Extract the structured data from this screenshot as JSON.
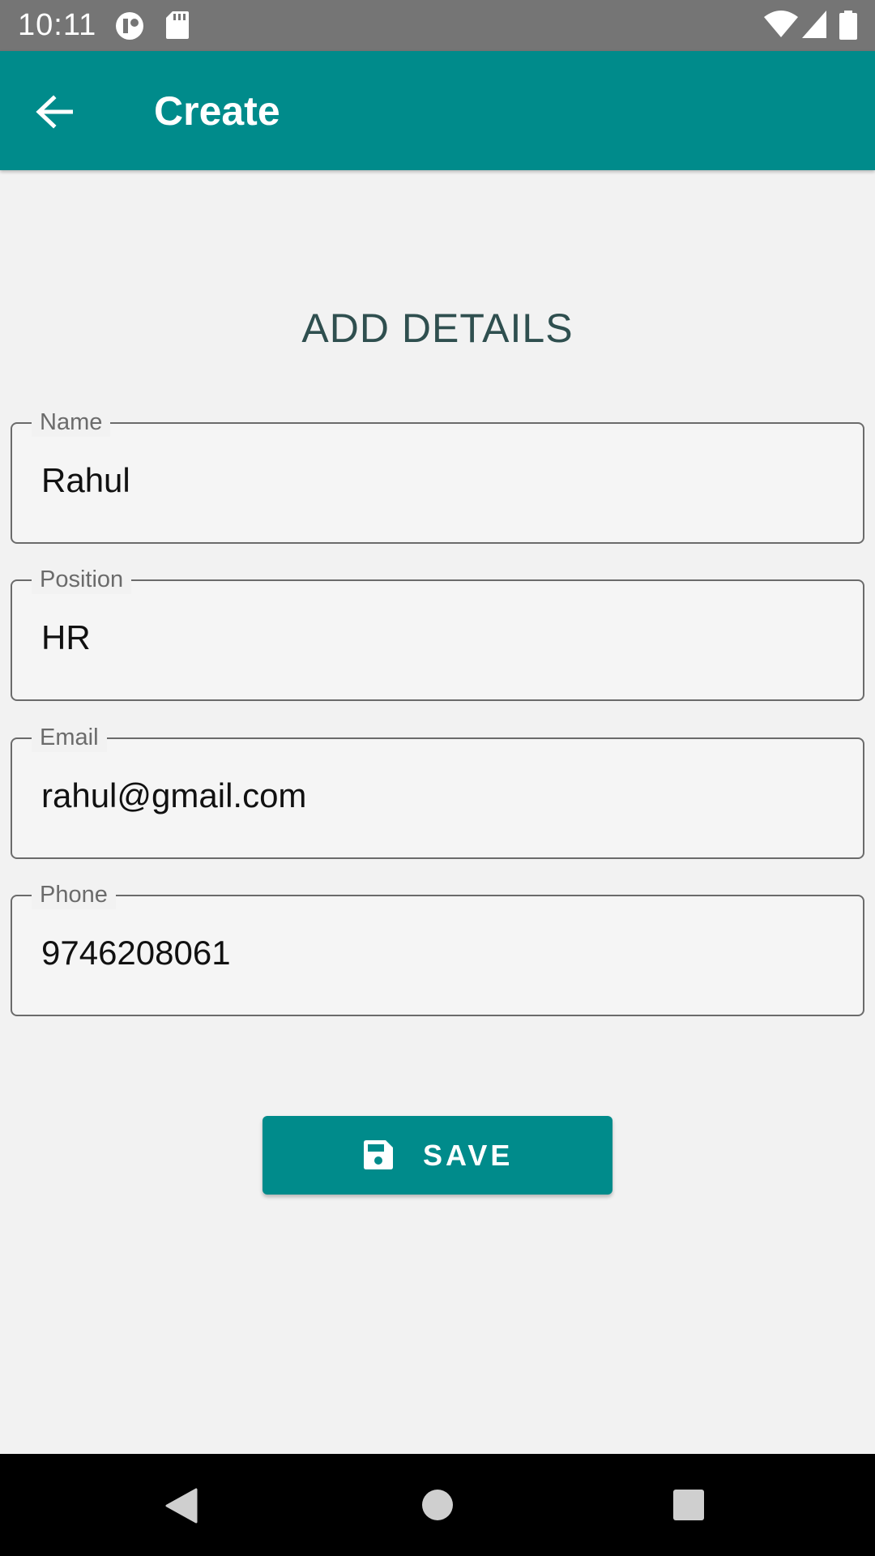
{
  "status_bar": {
    "time": "10:11",
    "left_icons": [
      "sync-icon",
      "sd-card-icon"
    ],
    "right_icons": [
      "wifi-icon",
      "signal-icon",
      "battery-icon"
    ]
  },
  "app_bar": {
    "back_icon": "arrow-back-icon",
    "title": "Create"
  },
  "form": {
    "heading": "ADD DETAILS",
    "fields": [
      {
        "label": "Name",
        "value": "Rahul"
      },
      {
        "label": "Position",
        "value": "HR"
      },
      {
        "label": "Email",
        "value": "rahul@gmail.com"
      },
      {
        "label": "Phone",
        "value": "9746208061"
      }
    ],
    "save_button": {
      "label": "SAVE",
      "icon": "save-icon"
    }
  },
  "nav_bar": {
    "buttons": [
      "back-triangle-icon",
      "home-circle-icon",
      "recents-square-icon"
    ]
  },
  "colors": {
    "app_bar": "#008b8b",
    "status_bar": "#757575",
    "heading_text": "#2f4f4f",
    "background": "#f2f2f2"
  }
}
